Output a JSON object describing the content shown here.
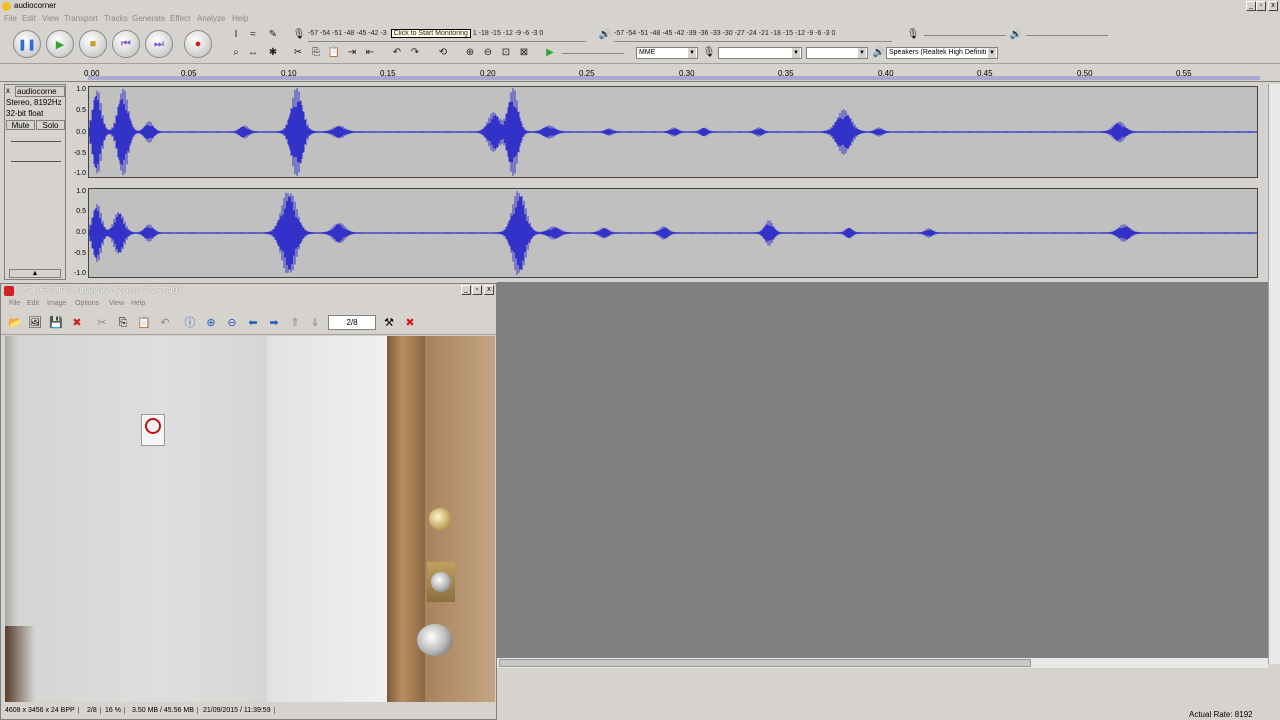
{
  "window": {
    "title": "audiocorner"
  },
  "menu": [
    "File",
    "Edit",
    "View",
    "Transport",
    "Tracks",
    "Generate",
    "Effect",
    "Analyze",
    "Help"
  ],
  "meters": {
    "rec_ticks": "-57 -54 -51 -48 -45 -42 -3",
    "rec_tooltip": "Click to Start Monitoring",
    "rec_ticks2": "1 -18 -15 -12  -9  -6  -3  0",
    "play_ticks": "-57 -54 -51 -48 -45 -42 -39 -36 -33 -30 -27 -24 -21 -18 -15 -12  -9  -6  -3  0"
  },
  "devices": {
    "host": "MME",
    "output": "Speakers (Realtek High Definiti"
  },
  "ruler": {
    "ticks": [
      "0.00",
      "0.05",
      "0.10",
      "0.15",
      "0.20",
      "0.25",
      "0.30",
      "0.35",
      "0.40",
      "0.45",
      "0.50",
      "0.55"
    ]
  },
  "track": {
    "name": "audiocorne",
    "info1": "Stereo, 8192Hz",
    "info2": "32-bit float",
    "mute": "Mute",
    "solo": "Solo",
    "y_labels": [
      "1.0",
      "0.5",
      "0.0",
      "-0.5",
      "-1.0"
    ]
  },
  "status": {
    "rate": "Actual Rate: 8192"
  },
  "irfanview": {
    "title": "IMG_0695.JPG - IrfanView (Zoom: 732 x 549)",
    "menu": [
      "File",
      "Edit",
      "Image",
      "Options",
      "View",
      "Help"
    ],
    "page": "2/8",
    "status": [
      "4608 x 3456 x 24 BPP",
      "2/8",
      "16 %",
      "3.50 MB / 45.56 MB",
      "21/09/2015 / 11:39:59"
    ]
  }
}
